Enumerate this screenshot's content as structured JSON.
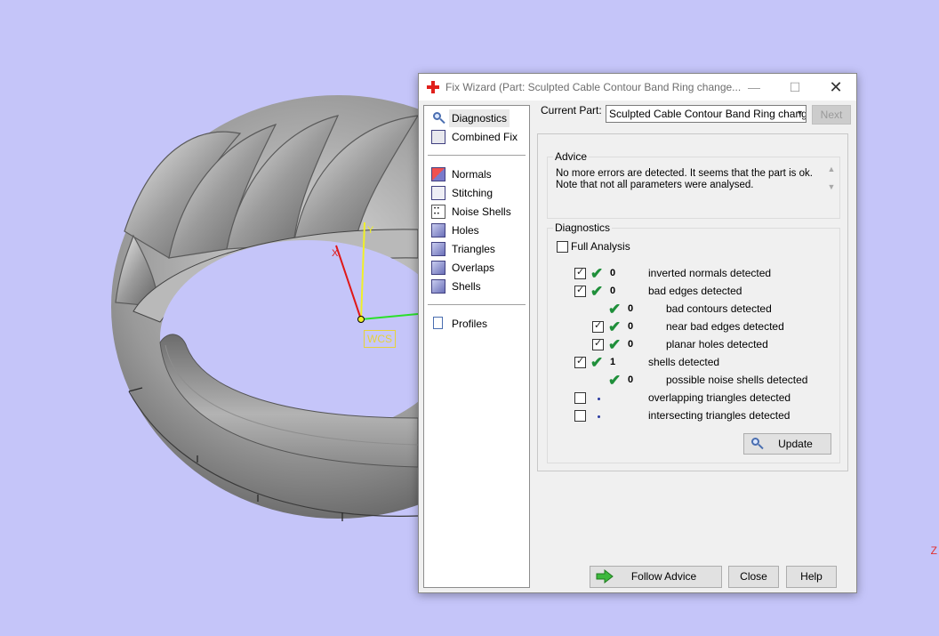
{
  "viewport": {
    "wcs_label": "WCS",
    "axis_y_label": "Y",
    "axis_x_label": "X",
    "edge_mark": "Z"
  },
  "dialog": {
    "title": "Fix Wizard (Part: Sculpted Cable Contour Band Ring change...",
    "window_controls": {
      "minimize": "—",
      "maximize": "☐",
      "close": "✕"
    },
    "nav": {
      "group1": [
        {
          "label": "Diagnostics",
          "icon": "magnifier-icon",
          "selected": true
        },
        {
          "label": "Combined Fix",
          "icon": "cube-icon"
        }
      ],
      "group2": [
        {
          "label": "Normals",
          "icon": "normals-cube-icon"
        },
        {
          "label": "Stitching",
          "icon": "stitching-cube-icon"
        },
        {
          "label": "Noise Shells",
          "icon": "noise-shells-icon"
        },
        {
          "label": "Holes",
          "icon": "holes-cube-icon"
        },
        {
          "label": "Triangles",
          "icon": "triangles-cube-icon"
        },
        {
          "label": "Overlaps",
          "icon": "overlaps-cube-icon"
        },
        {
          "label": "Shells",
          "icon": "shells-cube-icon"
        }
      ],
      "group3": [
        {
          "label": "Profiles",
          "icon": "document-icon"
        }
      ]
    },
    "current_part": {
      "label": "Current Part:",
      "value": "Sculpted Cable Contour Band Ring change"
    },
    "next_label": "Next",
    "advice": {
      "title": "Advice",
      "line1": "No more errors are detected. It seems that the part is ok.",
      "line2": "Note that not all parameters were analysed."
    },
    "diagnostics": {
      "title": "Diagnostics",
      "full_analysis": "Full Analysis",
      "rows": [
        {
          "checked": true,
          "status": "ok",
          "count": "0",
          "text": "inverted normals detected",
          "indent": 0,
          "has_check": true
        },
        {
          "checked": true,
          "status": "ok",
          "count": "0",
          "text": "bad edges detected",
          "indent": 0,
          "has_check": true
        },
        {
          "checked": false,
          "status": "ok",
          "count": "0",
          "text": "bad contours detected",
          "indent": 1,
          "has_check": false
        },
        {
          "checked": true,
          "status": "ok",
          "count": "0",
          "text": "near bad edges detected",
          "indent": 1,
          "has_check": true
        },
        {
          "checked": true,
          "status": "ok",
          "count": "0",
          "text": "planar holes detected",
          "indent": 1,
          "has_check": true
        },
        {
          "checked": true,
          "status": "ok",
          "count": "1",
          "text": "shells detected",
          "indent": 0,
          "has_check": true
        },
        {
          "checked": false,
          "status": "ok",
          "count": "0",
          "text": "possible noise shells detected",
          "indent": 1,
          "has_check": false
        },
        {
          "checked": false,
          "status": "pending",
          "count": "",
          "text": "overlapping triangles detected",
          "indent": 0,
          "has_check": true
        },
        {
          "checked": false,
          "status": "pending",
          "count": "",
          "text": "intersecting triangles detected",
          "indent": 0,
          "has_check": true
        }
      ],
      "update_label": "Update"
    },
    "buttons": {
      "follow_advice": "Follow Advice",
      "close": "Close",
      "help": "Help"
    }
  }
}
